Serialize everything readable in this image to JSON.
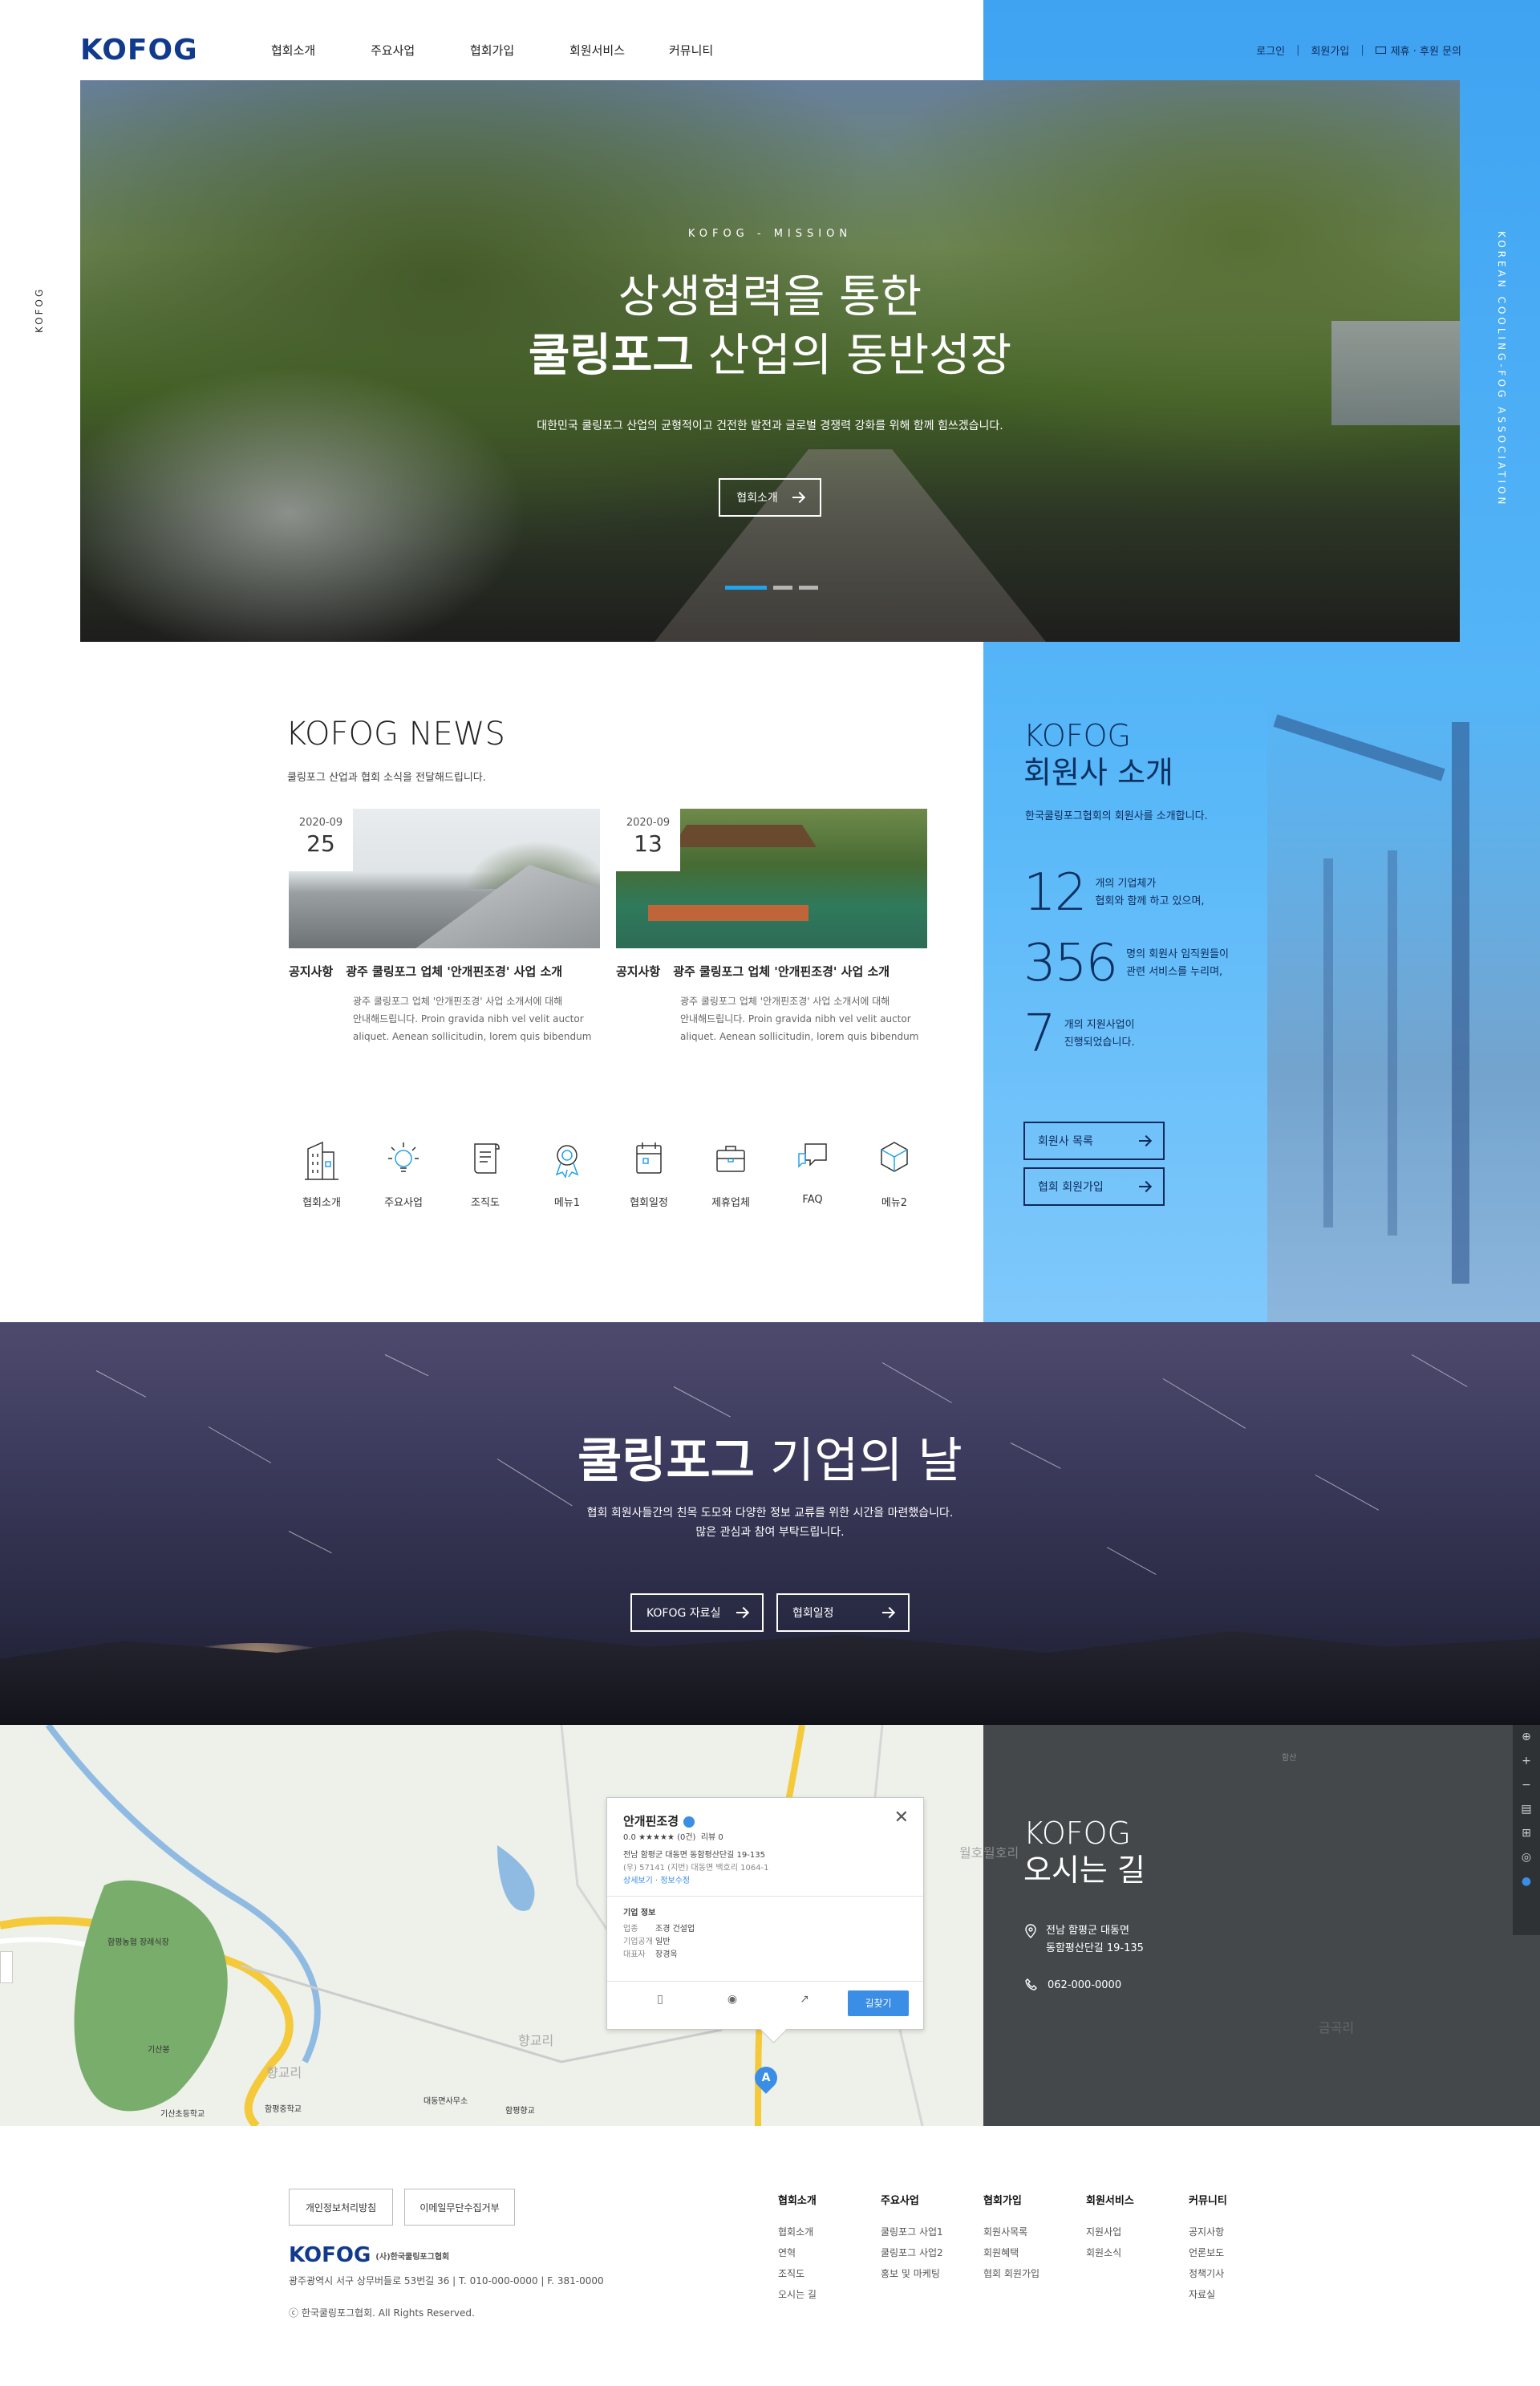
{
  "header": {
    "logo": "KOFOG",
    "nav": [
      "협회소개",
      "주요사업",
      "협회가입",
      "회원서비스",
      "커뮤니티"
    ],
    "util": {
      "login": "로그인",
      "join": "회원가입",
      "contact": "제휴 · 후원 문의"
    }
  },
  "hero": {
    "eyebrow": "KOFOG - MISSION",
    "title_line1": "상생협력을 통한",
    "title_bold": "쿨링포그",
    "title_line2_rest": " 산업의 동반성장",
    "desc": "대한민국 쿨링포그 산업의 균형적이고 건전한 발전과 글로벌 경쟁력 강화를 위해 함께 힘쓰겠습니다.",
    "button": "협회소개",
    "slides": 3,
    "active_slide": 1,
    "side_left": "KOFOG",
    "side_right": "KOREAN COOLING-FOG ASSOCIATION"
  },
  "news": {
    "title": "KOFOG NEWS",
    "subtitle": "쿨링포그 산업과 협회 소식을 전달해드립니다.",
    "items": [
      {
        "ym": "2020-09",
        "day": "25",
        "category": "공지사항",
        "title": "광주 쿨링포그 업체 '안개핀조경' 사업 소개",
        "body1": "광주 쿨링포그 업체 '안개핀조경' 사업 소개서에 대해",
        "body2": "안내해드립니다. Proin gravida nibh vel velit auctor",
        "body3": "aliquet. Aenean sollicitudin, lorem quis bibendum"
      },
      {
        "ym": "2020-09",
        "day": "13",
        "category": "공지사항",
        "title": "광주 쿨링포그 업체 '안개핀조경' 사업 소개",
        "body1": "광주 쿨링포그 업체 '안개핀조경' 사업 소개서에 대해",
        "body2": "안내해드립니다. Proin gravida nibh vel velit auctor",
        "body3": "aliquet. Aenean sollicitudin, lorem quis bibendum"
      }
    ]
  },
  "quick_menu": [
    {
      "label": "협회소개",
      "icon": "building-icon"
    },
    {
      "label": "주요사업",
      "icon": "lightbulb-icon"
    },
    {
      "label": "조직도",
      "icon": "scroll-icon"
    },
    {
      "label": "메뉴1",
      "icon": "award-icon"
    },
    {
      "label": "협회일정",
      "icon": "calendar-icon"
    },
    {
      "label": "제휴업체",
      "icon": "briefcase-icon"
    },
    {
      "label": "FAQ",
      "icon": "chat-icon"
    },
    {
      "label": "메뉴2",
      "icon": "cube-icon"
    }
  ],
  "members": {
    "title_line1": "KOFOG",
    "title_line2": "회원사 소개",
    "subtitle": "한국쿨링포그협회의 회원사를 소개합니다.",
    "stats": [
      {
        "num": "12",
        "line1": "개의 기업체가",
        "line2": "협회와 함께 하고 있으며,"
      },
      {
        "num": "356",
        "line1": "명의 회원사 임직원들이",
        "line2": "관련 서비스를 누리며,"
      },
      {
        "num": "7",
        "line1": "개의 지원사업이",
        "line2": "진행되었습니다."
      }
    ],
    "btn_list": "회원사 목록",
    "btn_join": "협회 회원가입"
  },
  "banner": {
    "title_bold": "쿨링포그",
    "title_rest": " 기업의 날",
    "desc1": "협회 회원사들간의 친목 도모와 다양한 정보 교류를 위한 시간을 마련했습니다.",
    "desc2": "많은 관심과 참여 부탁드립니다.",
    "btn1": "KOFOG 자료실",
    "btn2": "협회일정"
  },
  "map_popup": {
    "name": "안개핀조경",
    "rating": "0.0 ★★★★★ (0건)",
    "review": "리뷰 0",
    "addr1": "전남 함평군 대동면 동함평산단길 19-135",
    "addr2": "(우) 57141   (지번) 대동면 백호리 1064-1",
    "links": "상세보기 · 정보수정",
    "info_title": "기업 정보",
    "info": [
      {
        "k": "업종",
        "v": "조경 건설업"
      },
      {
        "k": "기업공개",
        "v": "일반"
      },
      {
        "k": "대표자",
        "v": "장경옥"
      }
    ],
    "find": "길찾기",
    "pin": "A"
  },
  "map_labels": [
    "함평농협 장례식장",
    "기산봉",
    "기산초등학교",
    "함평중학교",
    "대동면사무소",
    "함평향교",
    "향교리",
    "향교리",
    "월호리",
    "월호리",
    "함산",
    "금곡리"
  ],
  "location": {
    "title_line1": "KOFOG",
    "title_line2": "오시는 길",
    "addr1": "전남 함평군 대동면",
    "addr2": "동함평산단길 19-135",
    "phone": "062-000-0000"
  },
  "footer": {
    "btn_privacy": "개인정보처리방침",
    "btn_email": "이메일무단수집거부",
    "logo": "KOFOG",
    "logo_sub": "(사)한국쿨링포그협회",
    "address": "광주광역시 서구 상무버들로 53번길 36  |  T. 010-000-0000  |  F. 381-0000",
    "copy": "ⓒ 한국쿨링포그협회. All Rights Reserved.",
    "cols": [
      {
        "title": "협회소개",
        "items": [
          "협회소개",
          "연혁",
          "조직도",
          "오시는 길"
        ]
      },
      {
        "title": "주요사업",
        "items": [
          "쿨링포그 사업1",
          "쿨링포그 사업2",
          "홍보 및 마케팅"
        ]
      },
      {
        "title": "협회가입",
        "items": [
          "회원사목록",
          "회원혜택",
          "협회 회원가입"
        ]
      },
      {
        "title": "회원서비스",
        "items": [
          "지원사업",
          "회원소식"
        ]
      },
      {
        "title": "커뮤니티",
        "items": [
          "공지사항",
          "언론보도",
          "정책기사",
          "자료실"
        ]
      }
    ]
  },
  "colors": {
    "accent": "#23a3ea",
    "navy": "#123a8c",
    "panel_blue": "#4fa9f3",
    "map_blue": "#3a8ee6"
  }
}
